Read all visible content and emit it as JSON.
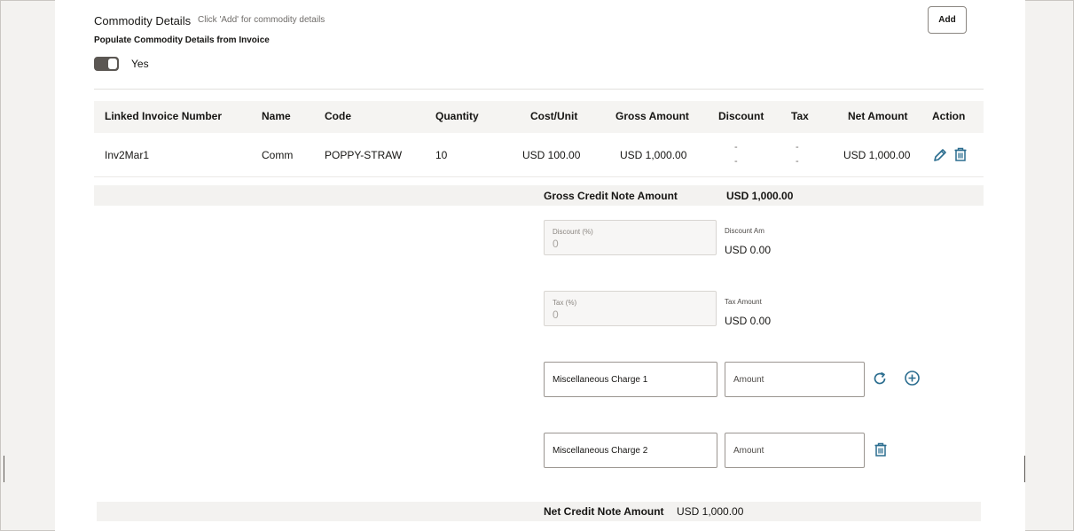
{
  "section": {
    "title": "Commodity Details",
    "hint": "Click 'Add' for commodity details",
    "add_label": "Add",
    "populate_label": "Populate Commodity Details from Invoice",
    "toggle_value": "Yes"
  },
  "table": {
    "headers": [
      "Linked Invoice Number",
      "Name",
      "Code",
      "Quantity",
      "Cost/Unit",
      "Gross Amount",
      "Discount",
      "Tax",
      "Net Amount",
      "Action"
    ],
    "rows": [
      {
        "invoice": "Inv2Mar1",
        "name": "Comm",
        "code": "POPPY-STRAW",
        "quantity": "10",
        "cost_unit": "USD 100.00",
        "gross_amount": "USD 1,000.00",
        "discount": "-",
        "tax": "-",
        "net_amount": "USD 1,000.00"
      }
    ]
  },
  "summary": {
    "gross_label": "Gross Credit Note Amount",
    "gross_value": "USD 1,000.00",
    "discount_field_label": "Discount (%)",
    "discount_field_value": "0",
    "discount_amount_label": "Discount Am",
    "discount_amount_value": "USD 0.00",
    "tax_field_label": "Tax (%)",
    "tax_field_value": "0",
    "tax_amount_label": "Tax Amount",
    "tax_amount_value": "USD 0.00",
    "misc_charges": [
      {
        "name": "Miscellaneous Charge 1",
        "amount_placeholder": "Amount"
      },
      {
        "name": "Miscellaneous Charge 2",
        "amount_placeholder": "Amount"
      }
    ],
    "net_label": "Net Credit Note Amount",
    "net_value": "USD 1,000.00"
  },
  "colors": {
    "accent": "#2b6d8f",
    "text": "#161513",
    "muted": "#6f6c69"
  },
  "icons": {
    "edit": "pencil-icon",
    "delete": "trash-icon",
    "refresh": "refresh-icon",
    "add": "plus-circle-icon"
  }
}
